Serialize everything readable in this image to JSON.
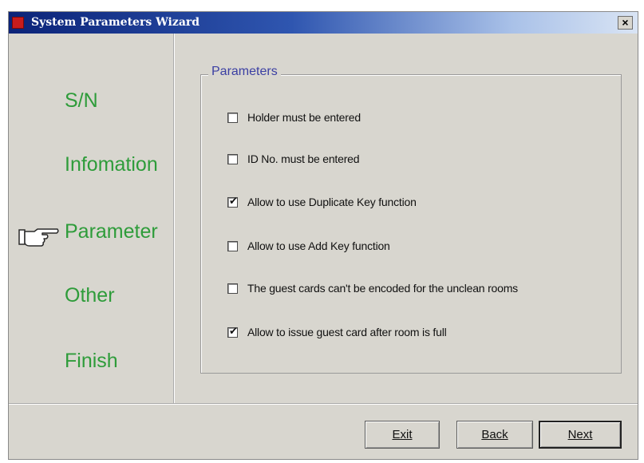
{
  "window": {
    "title": "System Parameters Wizard",
    "close_glyph": "×"
  },
  "steps": [
    {
      "label": "S/N",
      "active": false
    },
    {
      "label": "Infomation",
      "active": false
    },
    {
      "label": "Parameter",
      "active": true
    },
    {
      "label": "Other",
      "active": false
    },
    {
      "label": "Finish",
      "active": false
    }
  ],
  "active_indicator_icon": "pointing-hand-icon",
  "parameters": {
    "legend": "Parameters",
    "options": [
      {
        "label": "Holder  must be entered",
        "checked": false
      },
      {
        "label": "ID No. must be entered",
        "checked": false
      },
      {
        "label": "Allow to use Duplicate Key function",
        "checked": true
      },
      {
        "label": "Allow to use Add Key function",
        "checked": false
      },
      {
        "label": "The guest cards can't be encoded for the unclean rooms",
        "checked": false
      },
      {
        "label": "Allow to issue guest card after room is full",
        "checked": true
      }
    ]
  },
  "buttons": {
    "exit": "Exit",
    "back": "Back",
    "next": "Next"
  },
  "colors": {
    "step_text": "#2e9c3a",
    "legend_text": "#3b3fa3",
    "dialog_bg": "#d8d6cf"
  }
}
